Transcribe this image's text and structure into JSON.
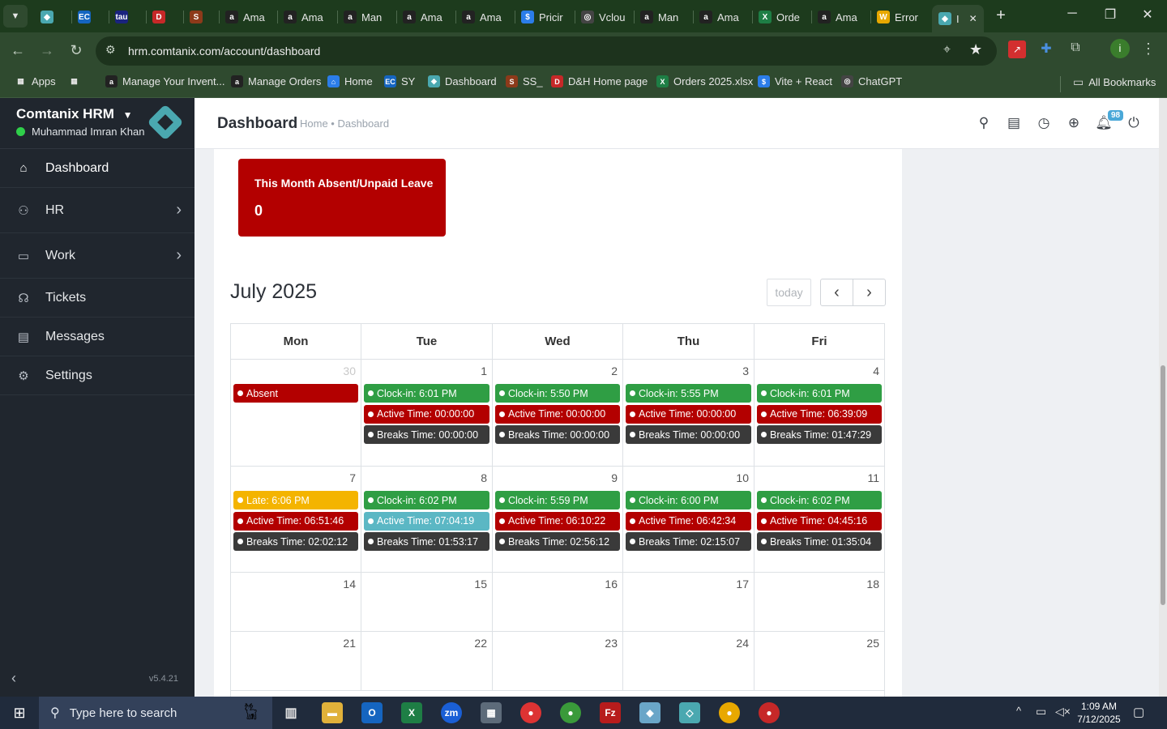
{
  "browser": {
    "tabs": [
      {
        "label": "",
        "icon": "comtanix"
      },
      {
        "label": "",
        "icon": "ec"
      },
      {
        "label": "",
        "icon": "tau"
      },
      {
        "label": "",
        "icon": "dh"
      },
      {
        "label": "",
        "icon": "ss"
      },
      {
        "label": "Ama",
        "icon": "amazon"
      },
      {
        "label": "Ama",
        "icon": "amazon"
      },
      {
        "label": "Man",
        "icon": "amazon"
      },
      {
        "label": "Ama",
        "icon": "amazon"
      },
      {
        "label": "Ama",
        "icon": "amazon"
      },
      {
        "label": "Pricir",
        "icon": "dollar"
      },
      {
        "label": "Vclou",
        "icon": "openai"
      },
      {
        "label": "Man",
        "icon": "amazon"
      },
      {
        "label": "Ama",
        "icon": "amazon"
      },
      {
        "label": "Orde",
        "icon": "excel"
      },
      {
        "label": "Ama",
        "icon": "amazon"
      },
      {
        "label": "Error",
        "icon": "w"
      },
      {
        "label": "I",
        "icon": "comtanix"
      }
    ],
    "url": "hrm.comtanix.com/account/dashboard",
    "bookmarks": [
      {
        "label": "Apps",
        "icon": "grid"
      },
      {
        "label": "",
        "icon": "grid2"
      },
      {
        "label": "Manage Your Invent...",
        "icon": "amazon"
      },
      {
        "label": "Manage Orders",
        "icon": "amazon"
      },
      {
        "label": "Home",
        "icon": "home"
      },
      {
        "label": "SY",
        "icon": "ec"
      },
      {
        "label": "Dashboard",
        "icon": "comtanix"
      },
      {
        "label": "SS_",
        "icon": "ss"
      },
      {
        "label": "D&H Home page",
        "icon": "dh"
      },
      {
        "label": "Orders 2025.xlsx",
        "icon": "excel"
      },
      {
        "label": "Vite + React",
        "icon": "dollar"
      },
      {
        "label": "ChatGPT",
        "icon": "openai"
      }
    ],
    "all_bookmarks": "All Bookmarks"
  },
  "sidebar": {
    "org": "Comtanix HRM",
    "user": "Muhammad Imran Khan",
    "items": [
      {
        "label": "Dashboard",
        "icon": "home-icon"
      },
      {
        "label": "HR",
        "icon": "users-icon"
      },
      {
        "label": "Work",
        "icon": "briefcase-icon"
      },
      {
        "label": "Tickets",
        "icon": "headset-icon"
      },
      {
        "label": "Messages",
        "icon": "message-icon"
      },
      {
        "label": "Settings",
        "icon": "gear-icon"
      }
    ],
    "version": "v5.4.21"
  },
  "header": {
    "title": "Dashboard",
    "breadcrumb": "Home • Dashboard",
    "notification_count": "98"
  },
  "absent_card": {
    "title": "This Month Absent/Unpaid Leave",
    "value": "0"
  },
  "calendar": {
    "title": "July 2025",
    "today_label": "today",
    "days": [
      "Mon",
      "Tue",
      "Wed",
      "Thu",
      "Fri"
    ],
    "weeks": [
      [
        {
          "day": "30",
          "other": true,
          "events": [
            {
              "text": "Absent",
              "color": "#b30000"
            }
          ]
        },
        {
          "day": "1",
          "events": [
            {
              "text": "Clock-in: 6:01 PM",
              "color": "#2f9e44"
            },
            {
              "text": "Active Time: 00:00:00",
              "color": "#b30000"
            },
            {
              "text": "Breaks Time: 00:00:00",
              "color": "#3a3a3a"
            }
          ]
        },
        {
          "day": "2",
          "events": [
            {
              "text": "Clock-in: 5:50 PM",
              "color": "#2f9e44"
            },
            {
              "text": "Active Time: 00:00:00",
              "color": "#b30000"
            },
            {
              "text": "Breaks Time: 00:00:00",
              "color": "#3a3a3a"
            }
          ]
        },
        {
          "day": "3",
          "events": [
            {
              "text": "Clock-in: 5:55 PM",
              "color": "#2f9e44"
            },
            {
              "text": "Active Time: 00:00:00",
              "color": "#b30000"
            },
            {
              "text": "Breaks Time: 00:00:00",
              "color": "#3a3a3a"
            }
          ]
        },
        {
          "day": "4",
          "events": [
            {
              "text": "Clock-in: 6:01 PM",
              "color": "#2f9e44"
            },
            {
              "text": "Active Time: 06:39:09",
              "color": "#b30000"
            },
            {
              "text": "Breaks Time: 01:47:29",
              "color": "#3a3a3a"
            }
          ]
        }
      ],
      [
        {
          "day": "7",
          "events": [
            {
              "text": "Late: 6:06 PM",
              "color": "#f4b400"
            },
            {
              "text": "Active Time: 06:51:46",
              "color": "#b30000"
            },
            {
              "text": "Breaks Time: 02:02:12",
              "color": "#3a3a3a"
            }
          ]
        },
        {
          "day": "8",
          "events": [
            {
              "text": "Clock-in: 6:02 PM",
              "color": "#2f9e44"
            },
            {
              "text": "Active Time: 07:04:19",
              "color": "#5bb7c4"
            },
            {
              "text": "Breaks Time: 01:53:17",
              "color": "#3a3a3a"
            }
          ]
        },
        {
          "day": "9",
          "events": [
            {
              "text": "Clock-in: 5:59 PM",
              "color": "#2f9e44"
            },
            {
              "text": "Active Time: 06:10:22",
              "color": "#b30000"
            },
            {
              "text": "Breaks Time: 02:56:12",
              "color": "#3a3a3a"
            }
          ]
        },
        {
          "day": "10",
          "events": [
            {
              "text": "Clock-in: 6:00 PM",
              "color": "#2f9e44"
            },
            {
              "text": "Active Time: 06:42:34",
              "color": "#b30000"
            },
            {
              "text": "Breaks Time: 02:15:07",
              "color": "#3a3a3a"
            }
          ]
        },
        {
          "day": "11",
          "events": [
            {
              "text": "Clock-in: 6:02 PM",
              "color": "#2f9e44"
            },
            {
              "text": "Active Time: 04:45:16",
              "color": "#b30000"
            },
            {
              "text": "Breaks Time: 01:35:04",
              "color": "#3a3a3a"
            }
          ]
        }
      ],
      [
        {
          "day": "14",
          "events": []
        },
        {
          "day": "15",
          "events": []
        },
        {
          "day": "16",
          "events": []
        },
        {
          "day": "17",
          "events": []
        },
        {
          "day": "18",
          "events": []
        }
      ],
      [
        {
          "day": "21",
          "events": []
        },
        {
          "day": "22",
          "events": []
        },
        {
          "day": "23",
          "events": []
        },
        {
          "day": "24",
          "events": []
        },
        {
          "day": "25",
          "events": []
        }
      ]
    ]
  },
  "taskbar": {
    "search_placeholder": "Type here to search",
    "time": "1:09 AM",
    "date": "7/12/2025"
  },
  "colors": {
    "sidebar": "#20262e",
    "accent_red": "#b30000",
    "green": "#2f9e44"
  }
}
